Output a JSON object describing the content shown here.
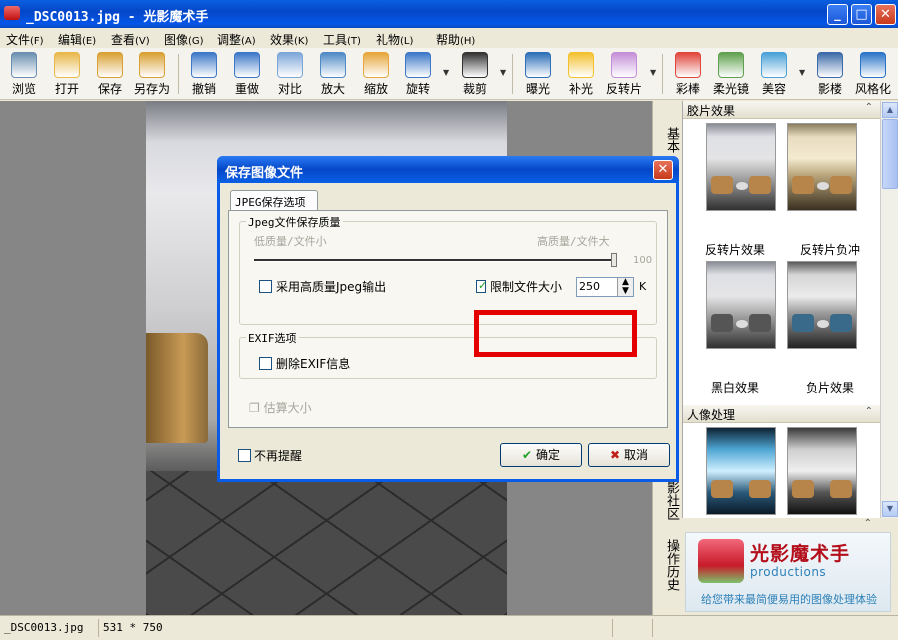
{
  "window": {
    "title": "_DSC0013.jpg - 光影魔术手",
    "minimize": "_",
    "maximize": "□",
    "close": "✕"
  },
  "menu": [
    {
      "label": "文件",
      "hotkey": "(F)"
    },
    {
      "label": "编辑",
      "hotkey": "(E)"
    },
    {
      "label": "查看",
      "hotkey": "(V)"
    },
    {
      "label": "图像",
      "hotkey": "(G)"
    },
    {
      "label": "调整",
      "hotkey": "(A)"
    },
    {
      "label": "效果",
      "hotkey": "(K)"
    },
    {
      "label": "工具",
      "hotkey": "(T)"
    },
    {
      "label": "礼物",
      "hotkey": "(L)"
    },
    {
      "label": "帮助",
      "hotkey": "(H)"
    }
  ],
  "toolbar": [
    {
      "label": "浏览",
      "icon": "eye-icon",
      "color": "#6a8fb0"
    },
    {
      "label": "打开",
      "icon": "folder-icon",
      "color": "#e8b84a"
    },
    {
      "label": "保存",
      "icon": "floppy-icon",
      "color": "#d9a033"
    },
    {
      "label": "另存为",
      "icon": "floppy-saveas-icon",
      "color": "#d9a033"
    },
    {
      "label": "撤销",
      "icon": "undo-icon",
      "color": "#3d78c8"
    },
    {
      "label": "重做",
      "icon": "redo-icon",
      "color": "#3d78c8"
    },
    {
      "label": "对比",
      "icon": "compare-icon",
      "color": "#7da6d8"
    },
    {
      "label": "放大",
      "icon": "zoom-in-icon",
      "color": "#4f8ac6"
    },
    {
      "label": "缩放",
      "icon": "resize-icon",
      "color": "#e6a63a"
    },
    {
      "label": "旋转",
      "icon": "rotate-icon",
      "color": "#3d78c8"
    },
    {
      "label": "裁剪",
      "icon": "crop-icon",
      "color": "#333333"
    },
    {
      "label": "曝光",
      "icon": "exposure-icon",
      "color": "#2d6fb8"
    },
    {
      "label": "补光",
      "icon": "bulb-icon",
      "color": "#f3c12e"
    },
    {
      "label": "反转片",
      "icon": "film-icon",
      "color": "#c48fd8"
    },
    {
      "label": "彩棒",
      "icon": "magic-wand-icon",
      "color": "#e0463c"
    },
    {
      "label": "柔光镜",
      "icon": "landscape-icon",
      "color": "#5fa04e"
    },
    {
      "label": "美容",
      "icon": "face-icon",
      "color": "#4aa1d8"
    },
    {
      "label": "影楼",
      "icon": "portrait-icon",
      "color": "#3c6aa8"
    },
    {
      "label": "风格化",
      "icon": "style-icon",
      "color": "#2a74c8"
    }
  ],
  "side_tabs": {
    "basic": "基本",
    "community": "影社区",
    "history": "操作历史"
  },
  "right_panel": {
    "film_section": {
      "title": "胶片效果",
      "items": [
        "反转片效果",
        "反转片负冲",
        "黑白效果",
        "负片效果"
      ]
    },
    "portrait_section": {
      "title": "人像处理"
    },
    "collapse_glyph": "⌃"
  },
  "promo": {
    "name": "光影魔术手",
    "sub": "productions",
    "tagline": "给您带来最简便易用的图像处理体验"
  },
  "status": {
    "filename": "_DSC0013.jpg",
    "dimensions": "531 * 750"
  },
  "dialog": {
    "title": "保存图像文件",
    "tab": "JPEG保存选项",
    "quality_group": "Jpeg文件保存质量",
    "low_label": "低质量/文件小",
    "high_label": "高质量/文件大",
    "quality_value": "100",
    "quality_fraction": 1.0,
    "high_quality_checkbox": "采用高质量Jpeg输出",
    "high_quality_checked": false,
    "limit_size_checkbox": "限制文件大小",
    "limit_size_checked": true,
    "limit_size_value": "250",
    "limit_unit": "K",
    "exif_group": "EXIF选项",
    "remove_exif_checkbox": "删除EXIF信息",
    "remove_exif_checked": false,
    "estimate_label": "估算大小",
    "dont_remind_checkbox": "不再提醒",
    "ok_label": "确定",
    "cancel_label": "取消"
  }
}
